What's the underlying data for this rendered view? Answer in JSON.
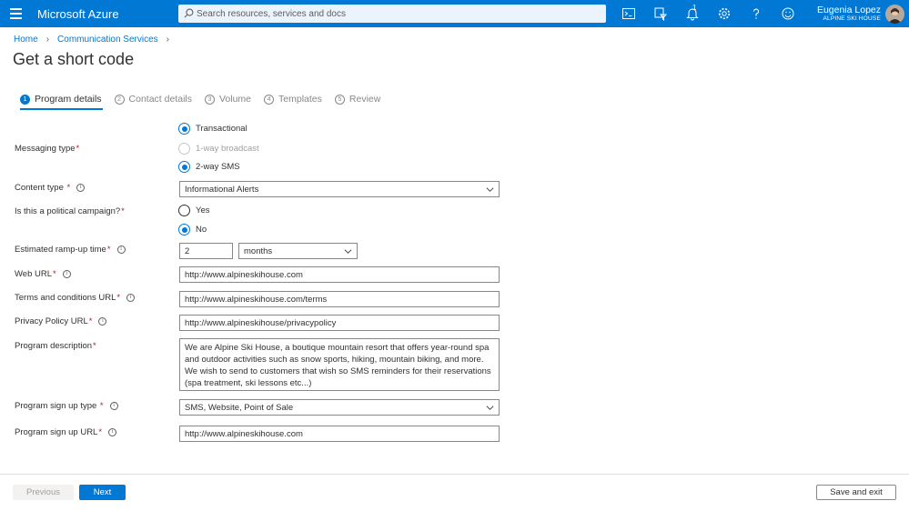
{
  "topbar": {
    "brand": "Microsoft Azure",
    "search_placeholder": "Search resources, services and docs",
    "notification_count": "1",
    "user_name": "Eugenia Lopez",
    "user_org": "ALPINE SKI HOUSE",
    "icons": [
      "cloud-shell-icon",
      "directory-filter-icon",
      "bell-icon",
      "gear-icon",
      "help-icon",
      "feedback-icon"
    ]
  },
  "breadcrumb": [
    "Home",
    "Communication Services"
  ],
  "page_title": "Get a short code",
  "steps": [
    {
      "num": "1",
      "label": "Program details",
      "active": true
    },
    {
      "num": "2",
      "label": "Contact details",
      "active": false
    },
    {
      "num": "3",
      "label": "Volume",
      "active": false
    },
    {
      "num": "4",
      "label": "Templates",
      "active": false
    },
    {
      "num": "5",
      "label": "Review",
      "active": false
    }
  ],
  "form": {
    "messaging_type": {
      "label": "Messaging type",
      "options": [
        "Transactional",
        "1-way broadcast",
        "2-way SMS"
      ]
    },
    "content_type": {
      "label": "Content type",
      "value": "Informational Alerts"
    },
    "political": {
      "label": "Is this a political campaign?",
      "options": [
        "Yes",
        "No"
      ]
    },
    "ramp_up": {
      "label": "Estimated ramp-up time",
      "value": "2",
      "unit": "months"
    },
    "web_url": {
      "label": "Web URL",
      "value": "http://www.alpineskihouse.com"
    },
    "terms_url": {
      "label": "Terms and conditions URL",
      "value": "http://www.alpineskihouse.com/terms"
    },
    "privacy_url": {
      "label": "Privacy Policy URL",
      "value": "http://www.alpineskihouse/privacypolicy"
    },
    "description": {
      "label": "Program description",
      "value": "We are Alpine Ski House, a boutique mountain resort that offers year-round spa and outdoor activities such as snow sports, hiking, mountain biking, and more. We wish to send to customers that wish so SMS reminders for their reservations (spa treatment, ski lessons etc...)"
    },
    "signup_type": {
      "label": "Program sign up type",
      "value": "SMS, Website, Point of Sale"
    },
    "signup_url": {
      "label": "Program sign up URL",
      "value": "http://www.alpineskihouse.com"
    }
  },
  "footer": {
    "previous": "Previous",
    "next": "Next",
    "save_exit": "Save and exit"
  },
  "colors": {
    "accent": "#0078d4",
    "required": "#a4262c"
  }
}
